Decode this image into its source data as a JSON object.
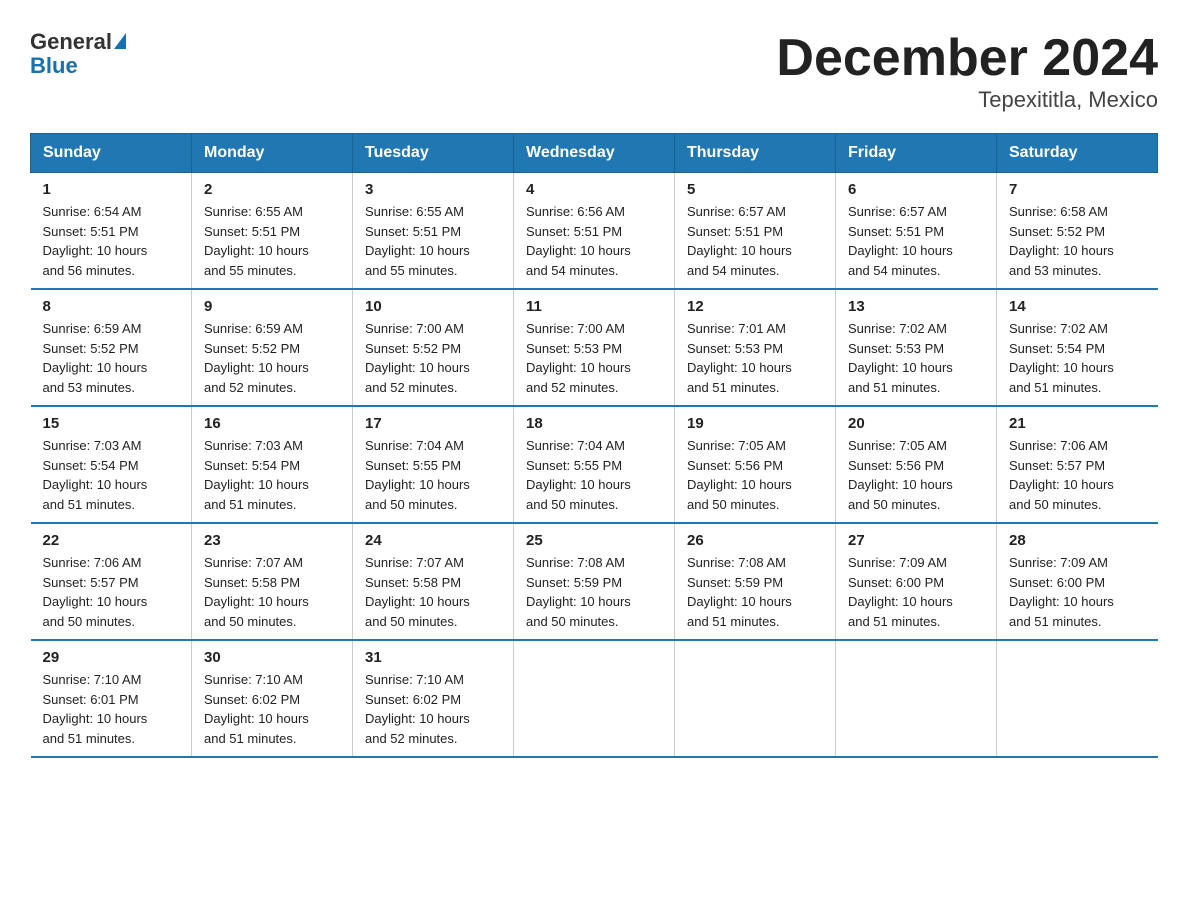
{
  "logo": {
    "general": "General",
    "blue": "Blue"
  },
  "title": "December 2024",
  "subtitle": "Tepexititla, Mexico",
  "days_of_week": [
    "Sunday",
    "Monday",
    "Tuesday",
    "Wednesday",
    "Thursday",
    "Friday",
    "Saturday"
  ],
  "weeks": [
    [
      {
        "num": "1",
        "sunrise": "6:54 AM",
        "sunset": "5:51 PM",
        "daylight": "10 hours and 56 minutes."
      },
      {
        "num": "2",
        "sunrise": "6:55 AM",
        "sunset": "5:51 PM",
        "daylight": "10 hours and 55 minutes."
      },
      {
        "num": "3",
        "sunrise": "6:55 AM",
        "sunset": "5:51 PM",
        "daylight": "10 hours and 55 minutes."
      },
      {
        "num": "4",
        "sunrise": "6:56 AM",
        "sunset": "5:51 PM",
        "daylight": "10 hours and 54 minutes."
      },
      {
        "num": "5",
        "sunrise": "6:57 AM",
        "sunset": "5:51 PM",
        "daylight": "10 hours and 54 minutes."
      },
      {
        "num": "6",
        "sunrise": "6:57 AM",
        "sunset": "5:51 PM",
        "daylight": "10 hours and 54 minutes."
      },
      {
        "num": "7",
        "sunrise": "6:58 AM",
        "sunset": "5:52 PM",
        "daylight": "10 hours and 53 minutes."
      }
    ],
    [
      {
        "num": "8",
        "sunrise": "6:59 AM",
        "sunset": "5:52 PM",
        "daylight": "10 hours and 53 minutes."
      },
      {
        "num": "9",
        "sunrise": "6:59 AM",
        "sunset": "5:52 PM",
        "daylight": "10 hours and 52 minutes."
      },
      {
        "num": "10",
        "sunrise": "7:00 AM",
        "sunset": "5:52 PM",
        "daylight": "10 hours and 52 minutes."
      },
      {
        "num": "11",
        "sunrise": "7:00 AM",
        "sunset": "5:53 PM",
        "daylight": "10 hours and 52 minutes."
      },
      {
        "num": "12",
        "sunrise": "7:01 AM",
        "sunset": "5:53 PM",
        "daylight": "10 hours and 51 minutes."
      },
      {
        "num": "13",
        "sunrise": "7:02 AM",
        "sunset": "5:53 PM",
        "daylight": "10 hours and 51 minutes."
      },
      {
        "num": "14",
        "sunrise": "7:02 AM",
        "sunset": "5:54 PM",
        "daylight": "10 hours and 51 minutes."
      }
    ],
    [
      {
        "num": "15",
        "sunrise": "7:03 AM",
        "sunset": "5:54 PM",
        "daylight": "10 hours and 51 minutes."
      },
      {
        "num": "16",
        "sunrise": "7:03 AM",
        "sunset": "5:54 PM",
        "daylight": "10 hours and 51 minutes."
      },
      {
        "num": "17",
        "sunrise": "7:04 AM",
        "sunset": "5:55 PM",
        "daylight": "10 hours and 50 minutes."
      },
      {
        "num": "18",
        "sunrise": "7:04 AM",
        "sunset": "5:55 PM",
        "daylight": "10 hours and 50 minutes."
      },
      {
        "num": "19",
        "sunrise": "7:05 AM",
        "sunset": "5:56 PM",
        "daylight": "10 hours and 50 minutes."
      },
      {
        "num": "20",
        "sunrise": "7:05 AM",
        "sunset": "5:56 PM",
        "daylight": "10 hours and 50 minutes."
      },
      {
        "num": "21",
        "sunrise": "7:06 AM",
        "sunset": "5:57 PM",
        "daylight": "10 hours and 50 minutes."
      }
    ],
    [
      {
        "num": "22",
        "sunrise": "7:06 AM",
        "sunset": "5:57 PM",
        "daylight": "10 hours and 50 minutes."
      },
      {
        "num": "23",
        "sunrise": "7:07 AM",
        "sunset": "5:58 PM",
        "daylight": "10 hours and 50 minutes."
      },
      {
        "num": "24",
        "sunrise": "7:07 AM",
        "sunset": "5:58 PM",
        "daylight": "10 hours and 50 minutes."
      },
      {
        "num": "25",
        "sunrise": "7:08 AM",
        "sunset": "5:59 PM",
        "daylight": "10 hours and 50 minutes."
      },
      {
        "num": "26",
        "sunrise": "7:08 AM",
        "sunset": "5:59 PM",
        "daylight": "10 hours and 51 minutes."
      },
      {
        "num": "27",
        "sunrise": "7:09 AM",
        "sunset": "6:00 PM",
        "daylight": "10 hours and 51 minutes."
      },
      {
        "num": "28",
        "sunrise": "7:09 AM",
        "sunset": "6:00 PM",
        "daylight": "10 hours and 51 minutes."
      }
    ],
    [
      {
        "num": "29",
        "sunrise": "7:10 AM",
        "sunset": "6:01 PM",
        "daylight": "10 hours and 51 minutes."
      },
      {
        "num": "30",
        "sunrise": "7:10 AM",
        "sunset": "6:02 PM",
        "daylight": "10 hours and 51 minutes."
      },
      {
        "num": "31",
        "sunrise": "7:10 AM",
        "sunset": "6:02 PM",
        "daylight": "10 hours and 52 minutes."
      },
      null,
      null,
      null,
      null
    ]
  ],
  "labels": {
    "sunrise": "Sunrise:",
    "sunset": "Sunset:",
    "daylight": "Daylight:"
  }
}
